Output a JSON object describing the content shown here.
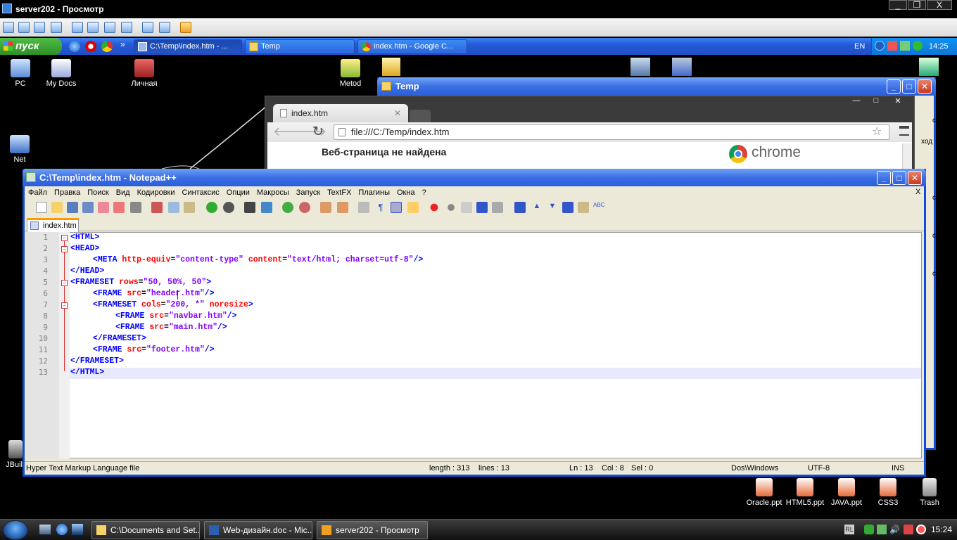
{
  "viewer": {
    "title": "server202 - Просмотр",
    "controls": [
      "_",
      "❐",
      "X"
    ]
  },
  "xp_taskbar": {
    "start_label": "пуск",
    "buttons": [
      {
        "label": "C:\\Temp\\index.htm - ...",
        "icon": "notepad-icon"
      },
      {
        "label": "Temp",
        "icon": "folder-icon"
      },
      {
        "label": "index.htm - Google C...",
        "icon": "chrome-icon"
      }
    ],
    "overflow": "»",
    "lang": "EN",
    "clock": "14:25"
  },
  "desktop_icons": [
    {
      "label": "PC",
      "icon": "computer-icon"
    },
    {
      "label": "My Docs",
      "icon": "documents-icon"
    },
    {
      "label": "Личная",
      "icon": "personal-icon"
    },
    {
      "label": "Metod",
      "icon": "metod-icon"
    },
    {
      "label": "Net",
      "icon": "network-icon"
    },
    {
      "label": "JBuil",
      "icon": "jbuilder-icon"
    }
  ],
  "temp_window": {
    "title": "Temp",
    "right_fragments": [
      "cls",
      "ход",
      "cls",
      "cls",
      "cls"
    ]
  },
  "chrome_window": {
    "tab_title": "index.htm",
    "address": "file:///C:/Temp/index.htm",
    "page_heading": "Веб-страница не найдена",
    "brand": "chrome"
  },
  "notepad": {
    "title": "C:\\Temp\\index.htm - Notepad++",
    "menu": [
      "Файл",
      "Правка",
      "Поиск",
      "Вид",
      "Кодировки",
      "Синтаксис",
      "Опции",
      "Макросы",
      "Запуск",
      "TextFX",
      "Плагины",
      "Окна",
      "?"
    ],
    "menu_close": "X",
    "tab": "index.htm",
    "lines": [
      {
        "n": "1"
      },
      {
        "n": "2"
      },
      {
        "n": "3"
      },
      {
        "n": "4"
      },
      {
        "n": "5"
      },
      {
        "n": "6"
      },
      {
        "n": "7"
      },
      {
        "n": "8"
      },
      {
        "n": "9"
      },
      {
        "n": "10"
      },
      {
        "n": "11"
      },
      {
        "n": "12"
      },
      {
        "n": "13"
      }
    ],
    "code": {
      "l1": "<HTML>",
      "l2": "<HEAD>",
      "l3_tag": "<META",
      "l3_a1": "http-equiv",
      "l3_v1": "\"content-type\"",
      "l3_a2": "content",
      "l3_v2": "\"text/html; charset=utf-8\"",
      "l3_end": "/>",
      "l4": "</HEAD>",
      "l5_tag": "<FRAMESET",
      "l5_a": "rows",
      "l5_v": "\"50, 50%, 50\"",
      "l5_end": ">",
      "l6_tag": "<FRAME",
      "l6_a": "src",
      "l6_v": "\"header.htm\"",
      "l6_end": "/>",
      "l7_tag": "<FRAMESET",
      "l7_a": "cols",
      "l7_v": "\"200, *\"",
      "l7_a2": "noresize",
      "l7_end": ">",
      "l8_tag": "<FRAME",
      "l8_a": "src",
      "l8_v": "\"navbar.htm\"",
      "l8_end": "/>",
      "l9_tag": "<FRAME",
      "l9_a": "src",
      "l9_v": "\"main.htm\"",
      "l9_end": "/>",
      "l10": "</FRAMESET>",
      "l11_tag": "<FRAME",
      "l11_a": "src",
      "l11_v": "\"footer.htm\"",
      "l11_end": "/>",
      "l12": "</FRAMESET>",
      "l13": "</HTML>",
      "eq": "="
    },
    "status": {
      "type": "Hyper Text Markup Language file",
      "length": "length : 313",
      "lines": "lines : 13",
      "ln": "Ln : 13",
      "col": "Col : 8",
      "sel": "Sel : 0",
      "eol": "Dos\\Windows",
      "enc": "UTF-8",
      "mode": "INS"
    }
  },
  "desktop_files": [
    {
      "label": "Oracle.ppt"
    },
    {
      "label": "HTML5.ppt"
    },
    {
      "label": "JAVA.ppt"
    },
    {
      "label": "CSS3"
    },
    {
      "label": "Trash"
    }
  ],
  "win7_taskbar": {
    "buttons": [
      {
        "label": "C:\\Documents and Set..."
      },
      {
        "label": "Web-дизайн.doc - Mic..."
      },
      {
        "label": "server202 - Просмотр"
      }
    ],
    "lang": "RL",
    "clock": "15:24"
  },
  "colors": {
    "xp_blue": "#2b5ed8",
    "tag": "#0000ff",
    "attr": "#ff0000",
    "value": "#8000ff"
  }
}
